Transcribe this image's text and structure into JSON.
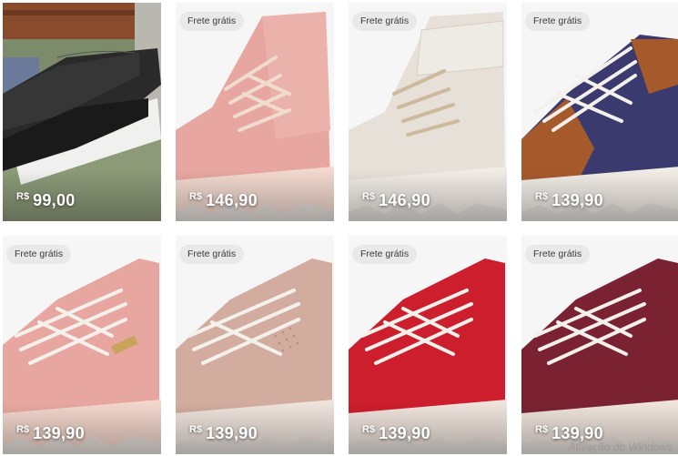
{
  "products": [
    {
      "badge": "",
      "currency": "R$",
      "price": "99,00",
      "color": "#1c1c1c",
      "model": "lace-slipon"
    },
    {
      "badge": "Frete grátis",
      "currency": "R$",
      "price": "146,90",
      "color": "#e8a9a0",
      "model": "hightop"
    },
    {
      "badge": "Frete grátis",
      "currency": "R$",
      "price": "146,90",
      "color": "#e9e3dc",
      "model": "hightop-strap"
    },
    {
      "badge": "Frete grátis",
      "currency": "R$",
      "price": "139,90",
      "color": "#3a3a6e",
      "accent": "#a65a2c",
      "model": "sneaker"
    },
    {
      "badge": "Frete grátis",
      "currency": "R$",
      "price": "139,90",
      "color": "#e7a7a0",
      "model": "sneaker"
    },
    {
      "badge": "Frete grátis",
      "currency": "R$",
      "price": "139,90",
      "color": "#d2ac9e",
      "model": "sneaker"
    },
    {
      "badge": "Frete grátis",
      "currency": "R$",
      "price": "139,90",
      "color": "#cc1e2c",
      "model": "sneaker"
    },
    {
      "badge": "Frete grátis",
      "currency": "R$",
      "price": "139,90",
      "color": "#7a2232",
      "model": "sneaker"
    }
  ],
  "watermark": "Ativação do Windows"
}
